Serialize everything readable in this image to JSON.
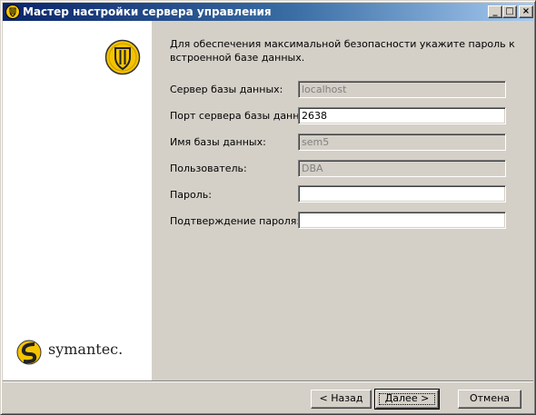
{
  "window": {
    "title": "Мастер настройки сервера управления",
    "controls": {
      "minimize": "_",
      "maximize": "□",
      "close": "×"
    }
  },
  "sidebar": {
    "brand": "symantec."
  },
  "form": {
    "intro": "Для обеспечения максимальной безопасности укажите пароль к встроенной базе данных.",
    "fields": [
      {
        "label": "Сервер базы данных:",
        "value": "localhost",
        "enabled": false
      },
      {
        "label": "Порт сервера базы данных:",
        "value": "2638",
        "enabled": true
      },
      {
        "label": "Имя базы данных:",
        "value": "sem5",
        "enabled": false
      },
      {
        "label": "Пользователь:",
        "value": "DBA",
        "enabled": false
      },
      {
        "label": "Пароль:",
        "value": "",
        "enabled": true
      },
      {
        "label": "Подтверждение пароля:",
        "value": "",
        "enabled": true
      }
    ]
  },
  "buttons": {
    "back": "< Назад",
    "next": "Далее >",
    "cancel": "Отмена"
  },
  "colors": {
    "titlebar_start": "#0a246a",
    "titlebar_end": "#a6caf0",
    "shield_yellow": "#f5c400"
  }
}
